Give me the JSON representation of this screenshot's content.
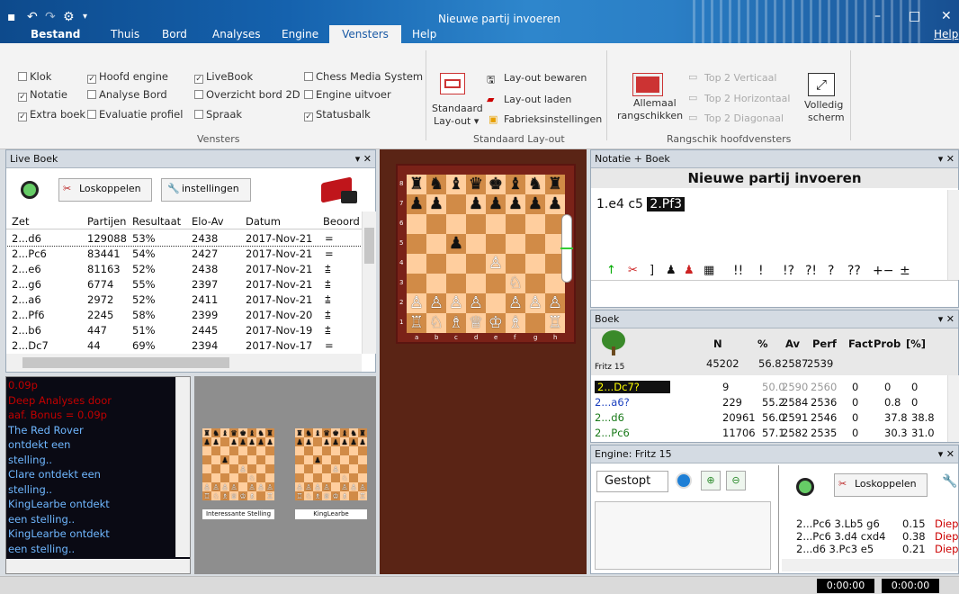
{
  "window": {
    "title": "Nieuwe partij invoeren"
  },
  "menu": {
    "items": [
      "Bestand",
      "Thuis",
      "Bord",
      "Analyses",
      "Engine",
      "Vensters",
      "Help"
    ],
    "help_right": "Help"
  },
  "ribbon": {
    "vensters_checks": [
      {
        "label": "Klok",
        "checked": false
      },
      {
        "label": "Notatie",
        "checked": true
      },
      {
        "label": "Extra boek",
        "checked": true
      },
      {
        "label": "Hoofd engine",
        "checked": true
      },
      {
        "label": "Analyse Bord",
        "checked": false
      },
      {
        "label": "Evaluatie profiel",
        "checked": false
      },
      {
        "label": "LiveBook",
        "checked": true
      },
      {
        "label": "Overzicht bord 2D",
        "checked": false
      },
      {
        "label": "Spraak",
        "checked": false
      },
      {
        "label": "Chess Media System",
        "checked": false
      },
      {
        "label": "Engine uitvoer",
        "checked": false
      },
      {
        "label": "Statusbalk",
        "checked": true
      }
    ],
    "group_vensters": "Vensters",
    "layout_btn_line1": "Standaard",
    "layout_btn_line2": "Lay-out ▾",
    "layout_save": "Lay-out bewaren",
    "layout_load": "Lay-out laden",
    "factory": "Fabrieksinstellingen",
    "group_layout": "Standaard Lay-out",
    "arrange_line1": "Allemaal",
    "arrange_line2": "rangschikken",
    "top2v": "Top 2 Verticaal",
    "top2h": "Top 2 Horizontaal",
    "top2d": "Top 2 Diagonaal",
    "fullscreen_line1": "Volledig",
    "fullscreen_line2": "scherm",
    "group_arrange": "Rangschik hoofdvensters"
  },
  "livebook": {
    "title": "Live Boek",
    "disconnect": "Loskoppelen",
    "settings": "instellingen",
    "columns": [
      "Zet",
      "Partijen",
      "Resultaat",
      "Elo-Av",
      "Datum",
      "Beoord"
    ],
    "rows": [
      [
        "2...d6",
        "129088",
        "53%",
        "2438",
        "2017-Nov-21",
        "="
      ],
      [
        "2...Pc6",
        "83441",
        "54%",
        "2427",
        "2017-Nov-21",
        "="
      ],
      [
        "2...e6",
        "81163",
        "52%",
        "2438",
        "2017-Nov-21",
        "⩲"
      ],
      [
        "2...g6",
        "6774",
        "55%",
        "2397",
        "2017-Nov-21",
        "⩲"
      ],
      [
        "2...a6",
        "2972",
        "52%",
        "2411",
        "2017-Nov-21",
        "⩲"
      ],
      [
        "2...Pf6",
        "2245",
        "58%",
        "2399",
        "2017-Nov-20",
        "⩲"
      ],
      [
        "2...b6",
        "447",
        "51%",
        "2445",
        "2017-Nov-19",
        "⩲"
      ],
      [
        "2...Dc7",
        "44",
        "69%",
        "2394",
        "2017-Nov-17",
        "="
      ]
    ]
  },
  "chat": {
    "lines": [
      {
        "text": "0.09p",
        "color": "#c00000"
      },
      {
        "text": "Deep Analyses door",
        "color": "#c00000"
      },
      {
        "text": "aaf. Bonus = 0.09p",
        "color": "#c00000"
      },
      {
        "text": "The Red Rover",
        "color": "#6fb7ff"
      },
      {
        "text": "ontdekt een",
        "color": "#6fb7ff"
      },
      {
        "text": "stelling..",
        "color": "#6fb7ff"
      },
      {
        "text": "Clare ontdekt een",
        "color": "#6fb7ff"
      },
      {
        "text": "stelling..",
        "color": "#6fb7ff"
      },
      {
        "text": "KingLearbe ontdekt",
        "color": "#6fb7ff"
      },
      {
        "text": "een stelling..",
        "color": "#6fb7ff"
      },
      {
        "text": "KingLearbe ontdekt",
        "color": "#6fb7ff"
      },
      {
        "text": "een stelling..",
        "color": "#6fb7ff"
      }
    ]
  },
  "thumbs": {
    "label1": "Interessante Stelling",
    "label2": "KingLearbe"
  },
  "board": {
    "files": [
      "a",
      "b",
      "c",
      "d",
      "e",
      "f",
      "g",
      "h"
    ],
    "ranks": [
      "8",
      "7",
      "6",
      "5",
      "4",
      "3",
      "2",
      "1"
    ]
  },
  "notation": {
    "header": "Notatie + Boek",
    "title": "Nieuwe partij invoeren",
    "moves": [
      "1.e4",
      "c5",
      "2.Pf3"
    ],
    "nags": [
      "!!",
      "!",
      "!?",
      "?!",
      "?",
      "??",
      "+−",
      "±"
    ]
  },
  "boek": {
    "header": "Boek",
    "columns": [
      "N",
      "%",
      "Av",
      "Perf",
      "Fact",
      "Prob",
      "[%]"
    ],
    "engine": "Fritz 15",
    "summary": [
      "45202",
      "56.8",
      "2587",
      "2539"
    ],
    "rows": [
      [
        "2...Dc7?",
        "9",
        "50.0",
        "2590",
        "2560",
        "0",
        "0",
        "0"
      ],
      [
        "2...a6?",
        "229",
        "55.2",
        "2584",
        "2536",
        "0",
        "0.8",
        "0"
      ],
      [
        "2...d6",
        "20961",
        "56.0",
        "2591",
        "2546",
        "0",
        "37.8",
        "38.8"
      ],
      [
        "2...Pc6",
        "11706",
        "57.1",
        "2582",
        "2535",
        "0",
        "30.3",
        "31.0"
      ]
    ]
  },
  "engine": {
    "header": "Engine: Fritz 15",
    "stopped": "Gestopt",
    "disconnect": "Loskoppelen",
    "lines": [
      [
        "2...Pc6 3.Lb5 g6",
        "0.15",
        "Diep"
      ],
      [
        "2...Pc6 3.d4 cxd4",
        "0.38",
        "Diep"
      ],
      [
        "2...d6 3.Pc3 e5",
        "0.21",
        "Diep"
      ]
    ]
  },
  "status": {
    "clock1": "0:00:00",
    "clock2": "0:00:00"
  },
  "colors": {
    "accent": "#1a5aa5",
    "titlebar": "#1562ae",
    "board_dark": "#d18b47",
    "board_light": "#ffce9e"
  }
}
